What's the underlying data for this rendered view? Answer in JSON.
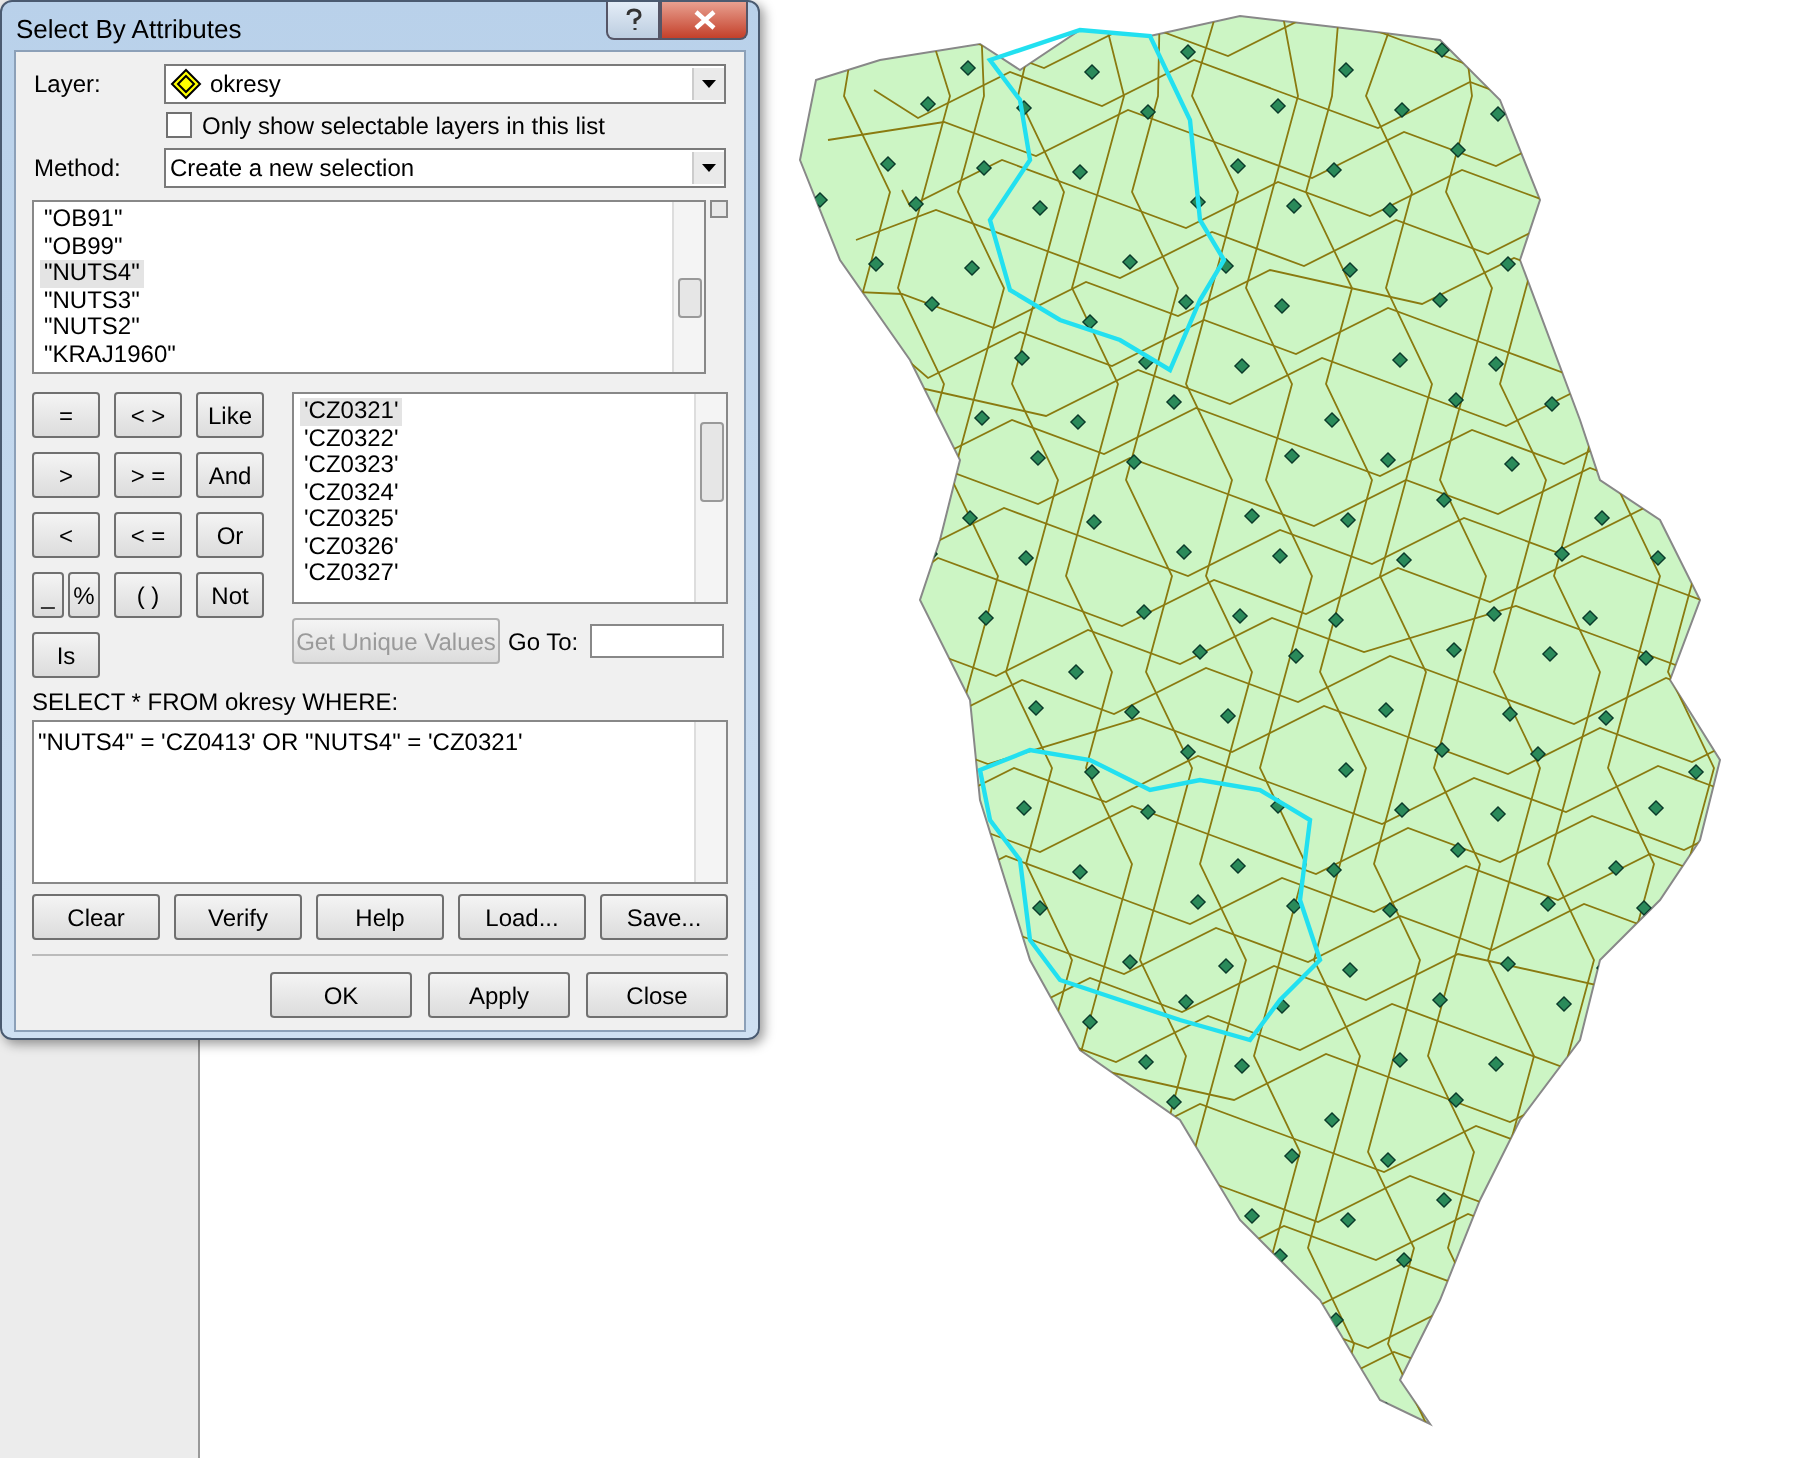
{
  "window": {
    "title": "Select By Attributes"
  },
  "layer": {
    "label": "Layer:",
    "value": "okresy"
  },
  "selectable_only": {
    "label": "Only show selectable layers in this list",
    "checked": false
  },
  "method": {
    "label": "Method:",
    "value": "Create a new selection"
  },
  "fields": [
    {
      "text": "\"OB91\"",
      "selected": false
    },
    {
      "text": "\"OB99\"",
      "selected": false
    },
    {
      "text": "\"NUTS4\"",
      "selected": true
    },
    {
      "text": "\"NUTS3\"",
      "selected": false
    },
    {
      "text": "\"NUTS2\"",
      "selected": false
    },
    {
      "text": "\"KRAJ1960\"",
      "selected": false
    }
  ],
  "operators": [
    [
      {
        "text": "=",
        "kind": "full"
      },
      {
        "text": "< >",
        "kind": "full"
      },
      {
        "text": "Like",
        "kind": "full"
      }
    ],
    [
      {
        "text": ">",
        "kind": "full"
      },
      {
        "text": "> =",
        "kind": "full"
      },
      {
        "text": "And",
        "kind": "full"
      }
    ],
    [
      {
        "text": "<",
        "kind": "full"
      },
      {
        "text": "< =",
        "kind": "full"
      },
      {
        "text": "Or",
        "kind": "full"
      }
    ],
    [
      {
        "text": "_",
        "kind": "half"
      },
      {
        "text": "%",
        "kind": "half"
      },
      {
        "text": "( )",
        "kind": "full"
      },
      {
        "text": "Not",
        "kind": "full"
      }
    ],
    [
      {
        "text": "Is",
        "kind": "full"
      }
    ]
  ],
  "values": [
    {
      "text": "'CZ0321'",
      "selected": true
    },
    {
      "text": "'CZ0322'",
      "selected": false
    },
    {
      "text": "'CZ0323'",
      "selected": false
    },
    {
      "text": "'CZ0324'",
      "selected": false
    },
    {
      "text": "'CZ0325'",
      "selected": false
    },
    {
      "text": "'CZ0326'",
      "selected": false
    },
    {
      "text": "'CZ0327'",
      "selected": false
    }
  ],
  "unique_values_button": {
    "label": "Get Unique Values",
    "disabled": true
  },
  "go_to": {
    "label": "Go To:"
  },
  "sql_label": "SELECT * FROM okresy WHERE:",
  "expression": "\"NUTS4\" = 'CZ0413' OR \"NUTS4\" = 'CZ0321'",
  "expression_buttons": [
    "Clear",
    "Verify",
    "Help",
    "Load...",
    "Save..."
  ],
  "dialog_buttons": [
    "OK",
    "Apply",
    "Close"
  ]
}
